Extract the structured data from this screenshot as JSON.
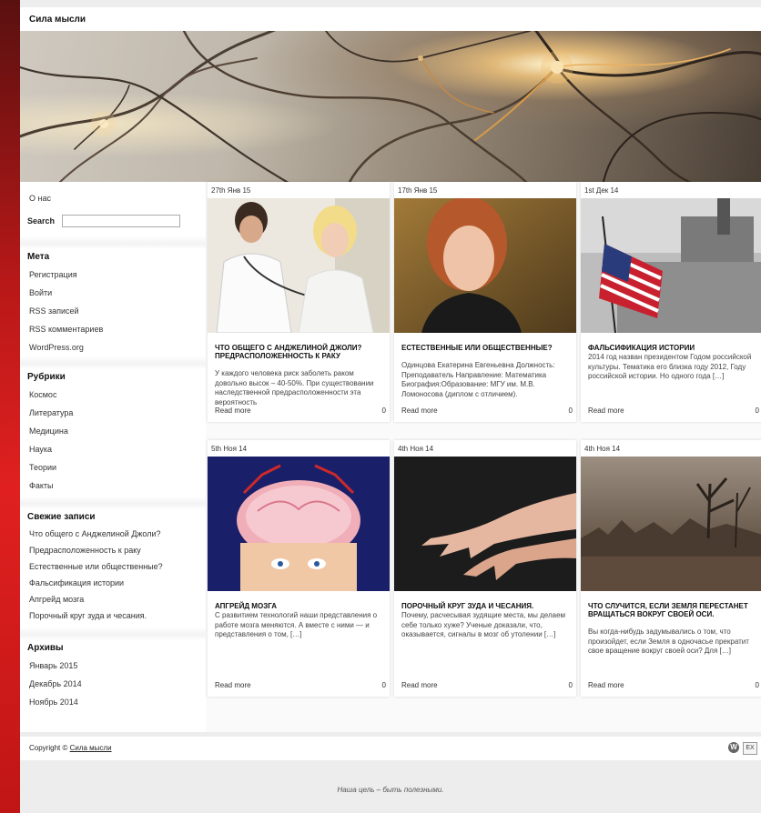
{
  "site": {
    "title": "Сила мысли",
    "tagline": "Наша цель – быть полезными."
  },
  "sidebar": {
    "about": "О нас",
    "search_label": "Search",
    "meta": {
      "title": "Мета",
      "items": [
        "Регистрация",
        "Войти",
        "RSS записей",
        "RSS комментариев",
        "WordPress.org"
      ]
    },
    "rubrics": {
      "title": "Рубрики",
      "items": [
        "Космос",
        "Литература",
        "Медицина",
        "Наука",
        "Теории",
        "Факты"
      ]
    },
    "recent": {
      "title": "Свежие записи",
      "items": [
        "Что общего с Анджелиной Джоли?",
        "Предрасположенность к раку",
        "Естественные или общественные?",
        "Фальсификация истории",
        "Апгрейд мозга",
        "Порочный круг зуда и чесания."
      ]
    },
    "archives": {
      "title": "Архивы",
      "items": [
        "Январь 2015",
        "Декабрь 2014",
        "Ноябрь 2014"
      ]
    }
  },
  "posts": [
    {
      "date": "27th Янв 15",
      "title": "ЧТО ОБЩЕГО С АНДЖЕЛИНОЙ ДЖОЛИ? ПРЕДРАСПОЛОЖЕННОСТЬ К РАКУ",
      "excerpt": "У каждого человека риск заболеть раком довольно высок – 40-50%. При существовании наследственной предрасположенности эта вероятность",
      "more": "Read more",
      "comments": "0"
    },
    {
      "date": "17th Янв 15",
      "title": "ЕСТЕСТВЕННЫЕ ИЛИ ОБЩЕСТВЕННЫЕ?",
      "excerpt": "Одинцова Екатерина Евгеньевна Должность: Преподаватель Направление: Математика Биография:Образование: МГУ им. М.В. Ломоносова (диплом с отличием).",
      "more": "Read more",
      "comments": "0"
    },
    {
      "date": "1st Дек 14",
      "title": "ФАЛЬСИФИКАЦИЯ ИСТОРИИ",
      "excerpt": "2014 год назван президентом Годом российской культуры. Тематика его близка году 2012, Году российской истории. Но одного года […]",
      "more": "Read more",
      "comments": "0"
    },
    {
      "date": "5th Ноя 14",
      "title": "АПГРЕЙД МОЗГА",
      "excerpt": "С развитием технологий наши представления о работе мозга меняются. А вместе с ними — и представления о том, […]",
      "more": "Read more",
      "comments": "0"
    },
    {
      "date": "4th Ноя 14",
      "title": "ПОРОЧНЫЙ КРУГ ЗУДА И ЧЕСАНИЯ.",
      "excerpt": "Почему, расчесывая зудящие места, мы делаем себе только хуже? Ученые доказали, что, оказывается, сигналы в мозг об утолении […]",
      "more": "Read more",
      "comments": "0"
    },
    {
      "date": "4th Ноя 14",
      "title": "ЧТО СЛУЧИТСЯ, ЕСЛИ ЗЕМЛЯ ПЕРЕСТАНЕТ ВРАЩАТЬСЯ ВОКРУГ СВОЕЙ ОСИ.",
      "excerpt": "Вы когда-нибудь задумывались о том, что произойдет, если Земля в одночасье прекратит свое вращение вокруг своей оси? Для […]",
      "more": "Read more",
      "comments": "0"
    }
  ],
  "footer": {
    "copyright_prefix": "Copyright ©",
    "copyright_link": "Сила мысли",
    "ex_icon": "EX"
  }
}
